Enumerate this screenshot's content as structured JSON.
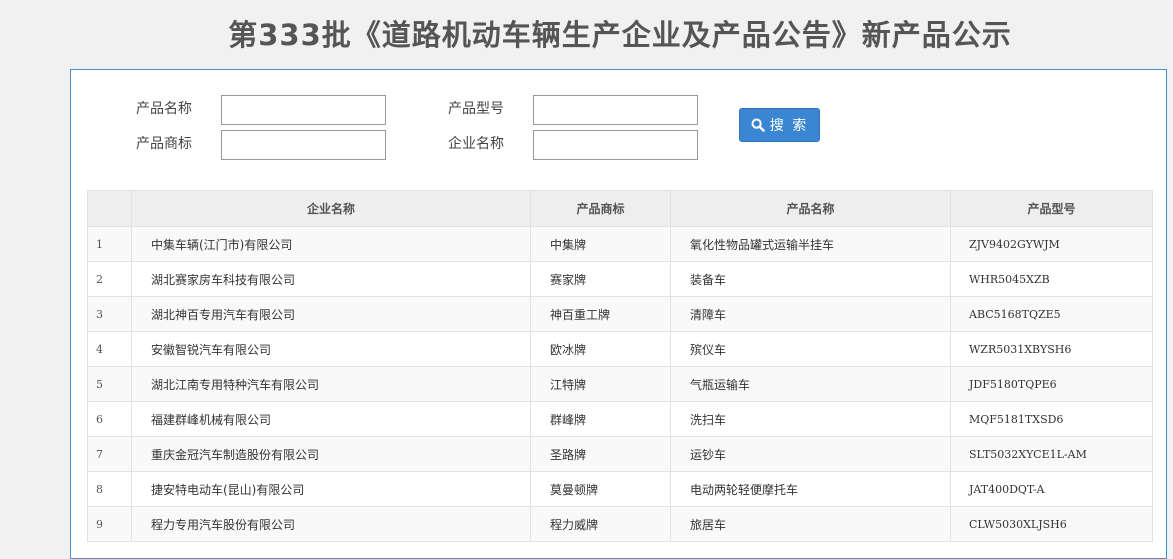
{
  "page": {
    "title": "第333批《道路机动车辆生产企业及产品公告》新产品公示"
  },
  "search_form": {
    "product_name_label": "产品名称",
    "product_model_label": "产品型号",
    "product_brand_label": "产品商标",
    "company_name_label": "企业名称",
    "product_name_value": "",
    "product_model_value": "",
    "product_brand_value": "",
    "company_name_value": "",
    "search_label": "搜 索"
  },
  "table": {
    "headers": {
      "index": "",
      "company": "企业名称",
      "brand": "产品商标",
      "name": "产品名称",
      "model": "产品型号"
    },
    "rows": [
      {
        "index": "1",
        "company": "中集车辆(江门市)有限公司",
        "brand": "中集牌",
        "name": "氧化性物品罐式运输半挂车",
        "model": "ZJV9402GYWJM"
      },
      {
        "index": "2",
        "company": "湖北赛家房车科技有限公司",
        "brand": "赛家牌",
        "name": "装备车",
        "model": "WHR5045XZB"
      },
      {
        "index": "3",
        "company": "湖北神百专用汽车有限公司",
        "brand": "神百重工牌",
        "name": "清障车",
        "model": "ABC5168TQZE5"
      },
      {
        "index": "4",
        "company": "安徽智锐汽车有限公司",
        "brand": "欧冰牌",
        "name": "殡仪车",
        "model": "WZR5031XBYSH6"
      },
      {
        "index": "5",
        "company": "湖北江南专用特种汽车有限公司",
        "brand": "江特牌",
        "name": "气瓶运输车",
        "model": "JDF5180TQPE6"
      },
      {
        "index": "6",
        "company": "福建群峰机械有限公司",
        "brand": "群峰牌",
        "name": "洗扫车",
        "model": "MQF5181TXSD6"
      },
      {
        "index": "7",
        "company": "重庆金冠汽车制造股份有限公司",
        "brand": "圣路牌",
        "name": "运钞车",
        "model": "SLT5032XYCE1L-AM"
      },
      {
        "index": "8",
        "company": "捷安特电动车(昆山)有限公司",
        "brand": "莫曼顿牌",
        "name": "电动两轮轻便摩托车",
        "model": "JAT400DQT-A"
      },
      {
        "index": "9",
        "company": "程力专用汽车股份有限公司",
        "brand": "程力威牌",
        "name": "旅居车",
        "model": "CLW5030XLJSH6"
      }
    ]
  },
  "colors": {
    "accent": "#3a86d2",
    "panel_border": "#4a90c8",
    "background": "#f1f1f1"
  }
}
